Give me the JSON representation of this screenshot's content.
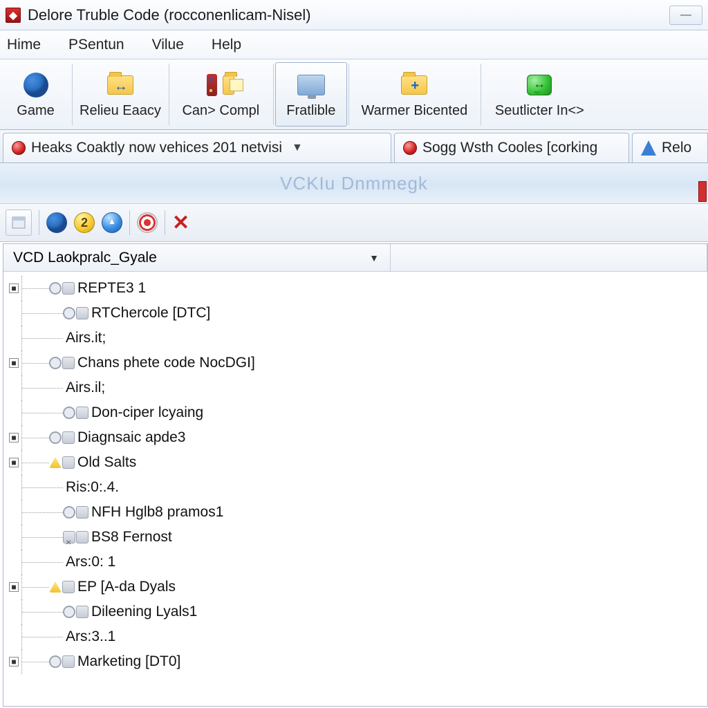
{
  "window": {
    "title": "Delore Truble Code (rocconenlicam-Nisel)"
  },
  "menu": {
    "items": [
      "Hime",
      "PSentun",
      "Vilue",
      "Help"
    ]
  },
  "toolbar": {
    "buttons": [
      {
        "label": "Game",
        "icon": "firefox-icon"
      },
      {
        "label": "Relieu Eaacy",
        "icon": "folder-arrow-icon"
      },
      {
        "label": "Can> Compl",
        "icon": "abacus-icon",
        "extra_icon": "folder-note-icon"
      },
      {
        "label": "Fratlible",
        "icon": "monitor-icon",
        "framed": true
      },
      {
        "label": "Warmer Bicented",
        "icon": "folder-plus-icon"
      },
      {
        "label": "Seutlicter In<>",
        "icon": "chat-bubble-icon"
      }
    ]
  },
  "tabs": [
    {
      "label": "Heaks Coaktly now vehices 201 netvisi",
      "icon": "red-dot-icon",
      "has_dropdown": true
    },
    {
      "label": "Sogg Wsth Cooles [corking",
      "icon": "red-dot-icon"
    },
    {
      "label": "Relo",
      "icon": "azure-icon"
    }
  ],
  "banner_text": "VCKIu  Dnmmegk",
  "toolbar2": {
    "badge_text": "2"
  },
  "tree_header": {
    "col1": "VCD Laokpralc_Gyale"
  },
  "tree": [
    {
      "depth": 0,
      "expand": "-",
      "icons": [
        "ring",
        "cube"
      ],
      "label": "REPTE3 1"
    },
    {
      "depth": 1,
      "expand": "",
      "icons": [
        "ring",
        "cube"
      ],
      "label": "RTChercole [DTC]"
    },
    {
      "depth": 1,
      "expand": "",
      "icons": [],
      "label": "Airs.it;"
    },
    {
      "depth": 0,
      "expand": "-",
      "icons": [
        "ring",
        "cube"
      ],
      "label": "Chans phete code NocDGI]"
    },
    {
      "depth": 1,
      "expand": "",
      "icons": [],
      "label": "Airs.il;"
    },
    {
      "depth": 1,
      "expand": "",
      "icons": [
        "ring",
        "cube"
      ],
      "label": "Don-ciper lcyaing"
    },
    {
      "depth": 0,
      "expand": "-",
      "icons": [
        "ring",
        "cube"
      ],
      "label": "Diagnsaic apde3"
    },
    {
      "depth": 0,
      "expand": "-",
      "icons": [
        "warn",
        "cube"
      ],
      "label": "Old Salts"
    },
    {
      "depth": 1,
      "expand": "",
      "icons": [],
      "label": "Ris:0:.4."
    },
    {
      "depth": 1,
      "expand": "",
      "icons": [
        "ring",
        "cube"
      ],
      "label": "NFH Hglb8 pramos1"
    },
    {
      "depth": 1,
      "expand": "",
      "icons": [
        "barx",
        "cube"
      ],
      "label": "BS8 Fernost"
    },
    {
      "depth": 1,
      "expand": "",
      "icons": [],
      "label": "Ars:0: 1"
    },
    {
      "depth": 0,
      "expand": "-",
      "icons": [
        "warn",
        "cube"
      ],
      "label": "EP [A-da Dyals"
    },
    {
      "depth": 1,
      "expand": "",
      "icons": [
        "ring",
        "cube"
      ],
      "label": "Dileening Lyals1"
    },
    {
      "depth": 1,
      "expand": "",
      "icons": [],
      "label": "Ars:3..1"
    },
    {
      "depth": 0,
      "expand": "-",
      "icons": [
        "ring",
        "cube"
      ],
      "label": "Marketing [DT0]"
    }
  ]
}
